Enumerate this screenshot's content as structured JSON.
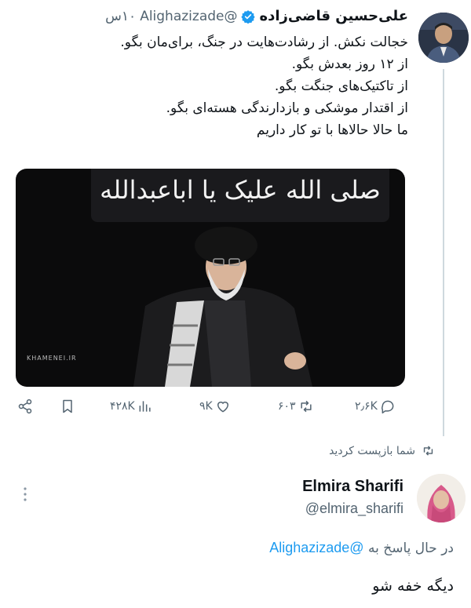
{
  "tweet": {
    "author_name": "علی‌حسین قاضی‌زاده",
    "handle": "@Alighazizade",
    "time": "۱۰س",
    "lines": [
      "خجالت نکش. از رشادت‌هایت در جنگ، برای‌مان بگو.",
      "از ۱۲ روز بعدش بگو.",
      "از تاکتیک‌های جنگت بگو.",
      "از اقتدار موشکی و بازدارندگی هسته‌ای بگو.",
      "ما حالا حالاها با تو کار داریم"
    ],
    "media": {
      "banner_text": "صلی الله علیک یا اباعبدالله",
      "watermark": "KHAMENEI.IR"
    },
    "actions": {
      "replies": "۲٫۶K",
      "retweets": "۶۰۳",
      "likes": "۹K",
      "views": "۴۲۸K"
    }
  },
  "retweet_context": "شما بازپست کردید",
  "reply": {
    "author_name": "Elmira Sharifi",
    "handle": "@elmira_sharifi",
    "replying_prefix": "در حال پاسخ به",
    "replying_to": "@Alighazizade",
    "text": "دیگه خفه شو"
  },
  "colors": {
    "accent": "#1d9bf0",
    "muted": "#536471",
    "thread_line": "#cfd9de"
  },
  "icons": [
    "verified-badge-icon",
    "reply-icon",
    "retweet-icon",
    "like-icon",
    "views-icon",
    "bookmark-icon",
    "share-icon",
    "more-icon"
  ]
}
